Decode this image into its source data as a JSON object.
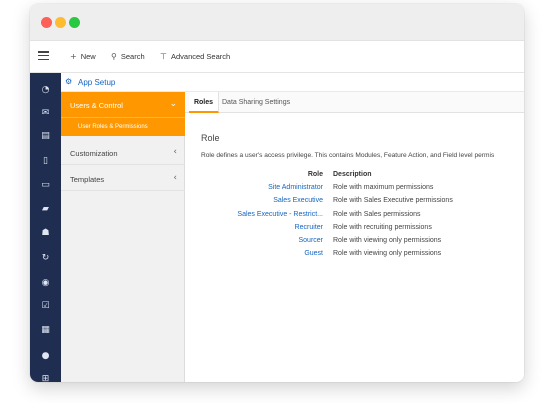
{
  "toolbar": {
    "new_label": "New",
    "search_label": "Search",
    "advanced_search_label": "Advanced Search"
  },
  "nav_icons": [
    "dashboard-icon",
    "mail-icon",
    "book-icon",
    "phone-icon",
    "id-card-icon",
    "briefcase-icon",
    "users-icon",
    "refresh-icon",
    "target-icon",
    "checklist-icon",
    "calendar-icon",
    "person-icon",
    "org-chart-icon"
  ],
  "app_setup": {
    "title": "App Setup"
  },
  "sidebar": {
    "items": [
      {
        "label": "Users & Control",
        "chevron": "⌄"
      },
      {
        "label": "User Roles & Permissions"
      },
      {
        "label": "Customization",
        "chevron": "‹"
      },
      {
        "label": "Templates",
        "chevron": "‹"
      }
    ]
  },
  "tabs": [
    {
      "label": "Roles"
    },
    {
      "label": "Data Sharing Settings"
    }
  ],
  "section": {
    "title": "Role",
    "description": "Role defines a user's access privilege. This contains Modules, Feature Action, and Field level permis"
  },
  "table": {
    "headers": {
      "role": "Role",
      "description": "Description"
    },
    "rows": [
      {
        "role": "Site Administrator",
        "description": "Role with maximum permissions"
      },
      {
        "role": "Sales Executive",
        "description": "Role with Sales Executive permissions"
      },
      {
        "role": "Sales Executive - Restrict...",
        "description": "Role with Sales permissions"
      },
      {
        "role": "Recruiter",
        "description": "Role with recruiting permissions"
      },
      {
        "role": "Sourcer",
        "description": "Role with viewing only permissions"
      },
      {
        "role": "Guest",
        "description": "Role with viewing only permissions"
      }
    ]
  },
  "colors": {
    "accent": "#ff9800",
    "nav_bg": "#1f2d50",
    "link": "#1565c0"
  }
}
